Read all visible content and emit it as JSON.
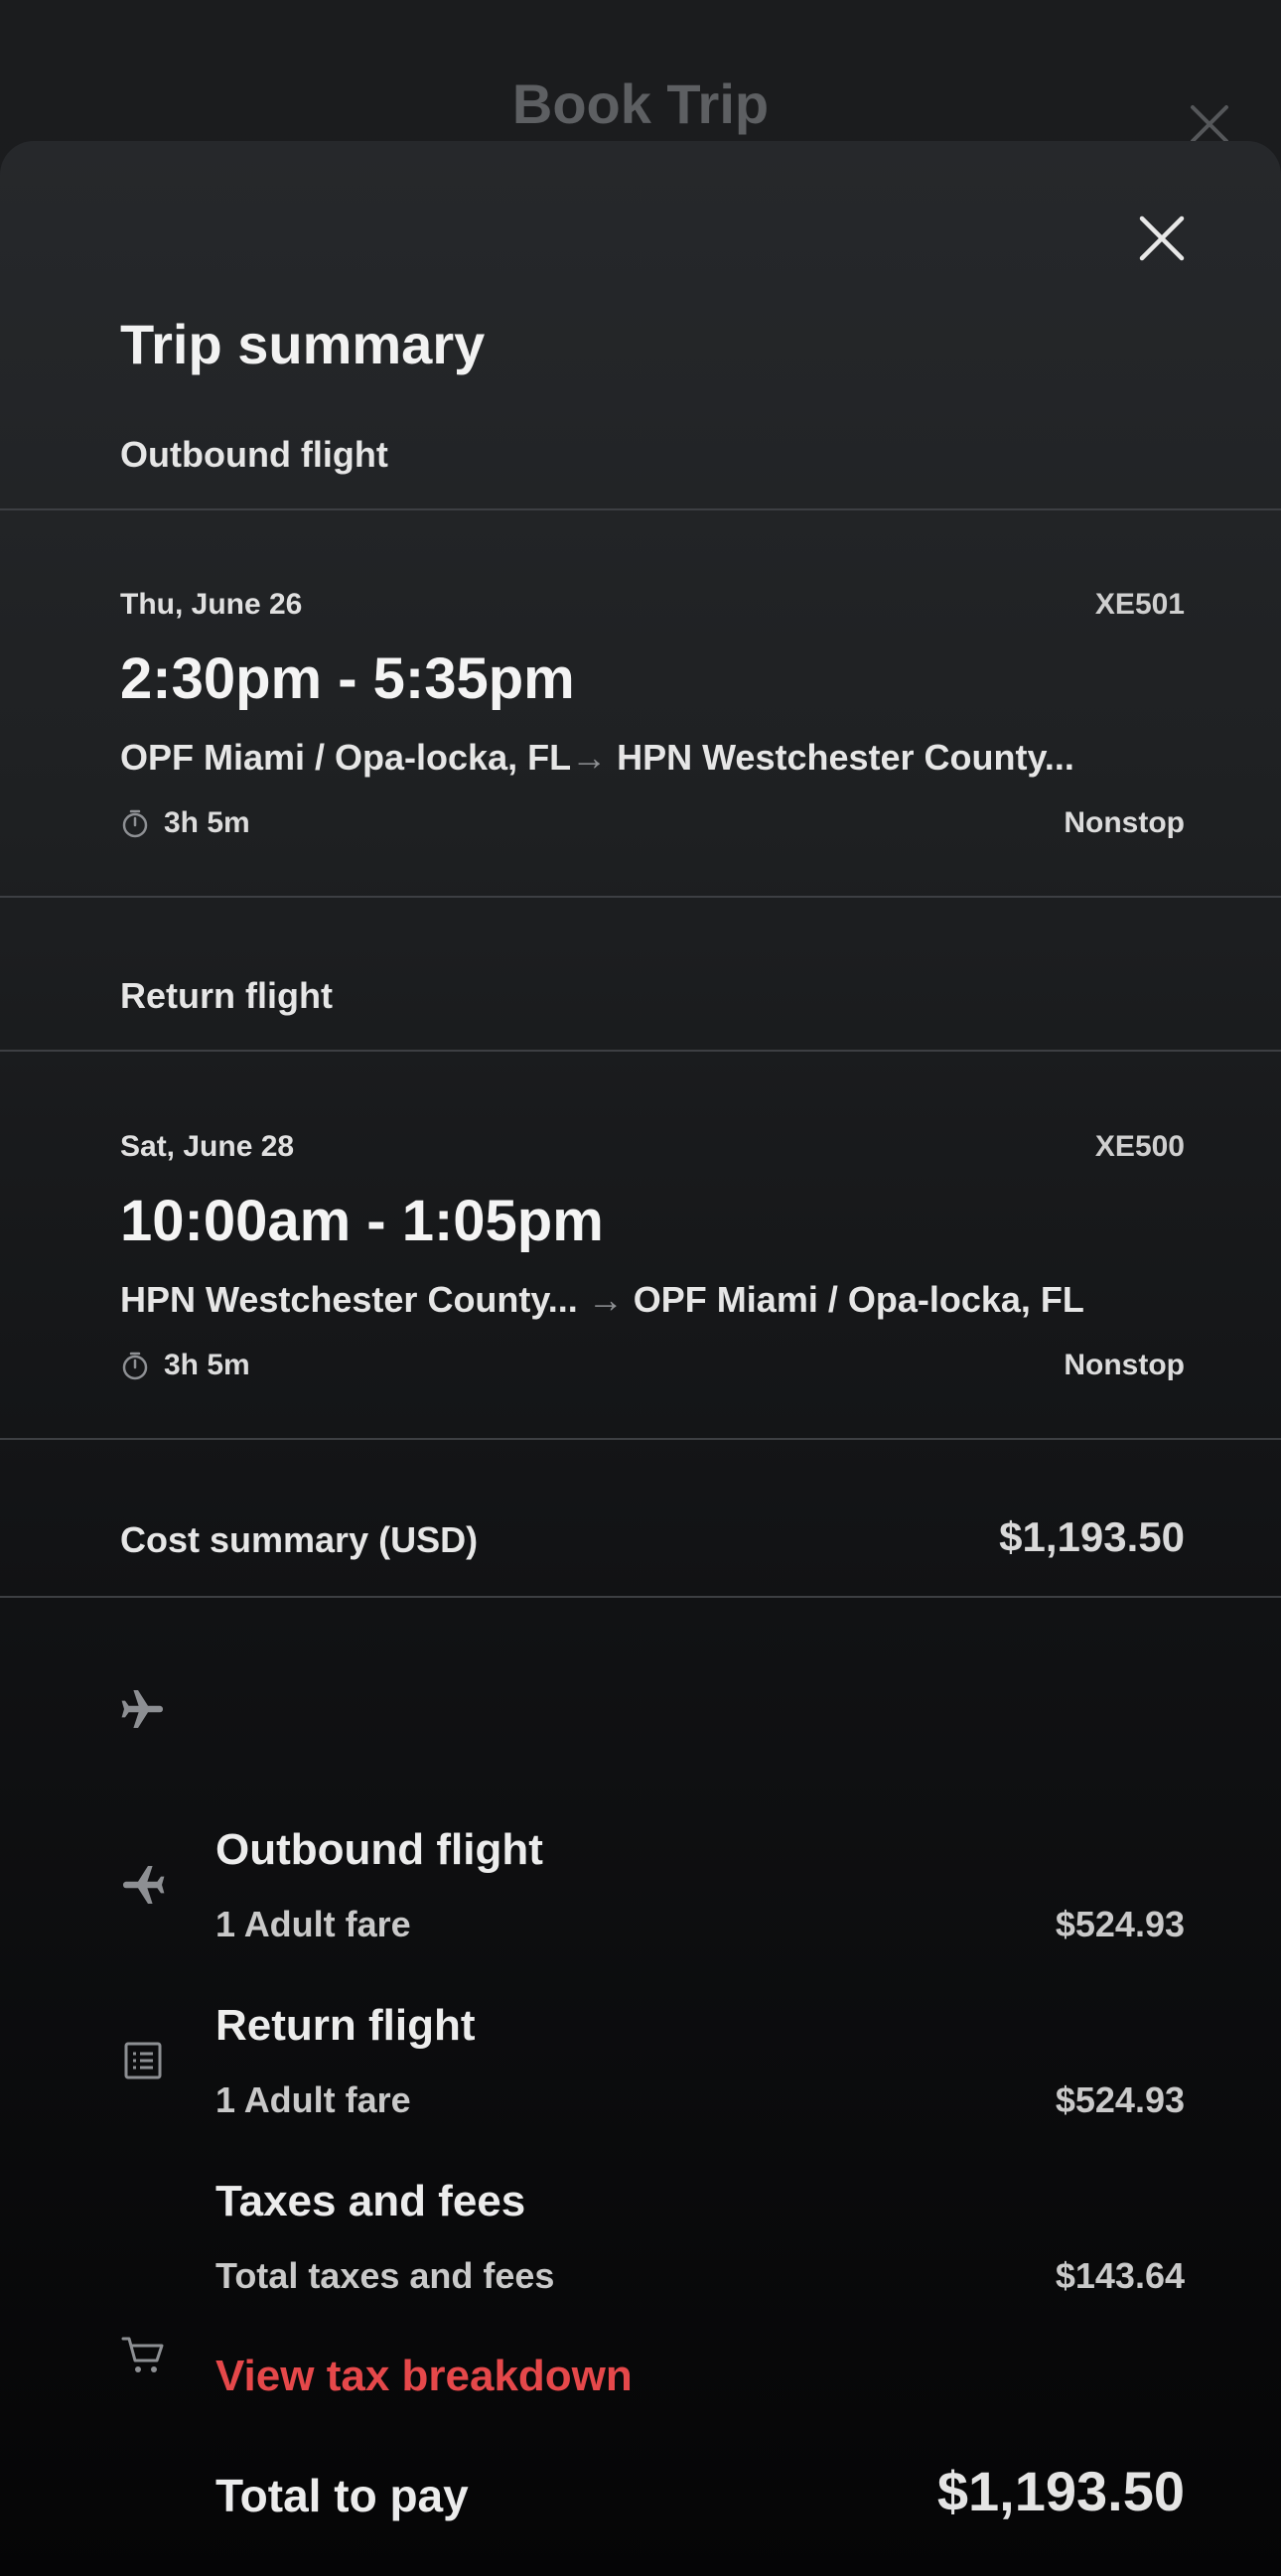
{
  "background": {
    "title": "Book Trip",
    "close_icon": "close-icon"
  },
  "sheet": {
    "title": "Trip summary",
    "close_icon": "close-icon"
  },
  "outbound": {
    "section_label": "Outbound flight",
    "date": "Thu, June 26",
    "flight_number": "XE501",
    "times": "2:30pm - 5:35pm",
    "origin": "OPF Miami / Opa-locka, FL",
    "arrow": "→",
    "destination": "HPN Westchester County...",
    "duration": "3h 5m",
    "stops": "Nonstop"
  },
  "return": {
    "section_label": "Return flight",
    "date": "Sat, June 28",
    "flight_number": "XE500",
    "times": "10:00am - 1:05pm",
    "origin": "HPN Westchester County...",
    "arrow": "→",
    "destination": "OPF Miami / Opa-locka, FL",
    "duration": "3h 5m",
    "stops": "Nonstop"
  },
  "cost": {
    "label": "Cost summary (USD)",
    "total": "$1,193.50",
    "items": [
      {
        "icon": "plane-takeoff-icon",
        "title": "Outbound flight",
        "subtitle": "1 Adult fare",
        "amount": "$524.93"
      },
      {
        "icon": "plane-landing-icon",
        "title": "Return flight",
        "subtitle": "1 Adult fare",
        "amount": "$524.93"
      },
      {
        "icon": "receipt-icon",
        "title": "Taxes and fees",
        "subtitle": "Total taxes and fees",
        "amount": "$143.64"
      }
    ],
    "tax_link": "View tax breakdown",
    "total_label": "Total to pay",
    "total_amount": "$1,193.50",
    "total_icon": "cart-icon"
  },
  "colors": {
    "accent_link": "#e5484a",
    "sheet_top": "#26282b",
    "background": "#151618"
  }
}
